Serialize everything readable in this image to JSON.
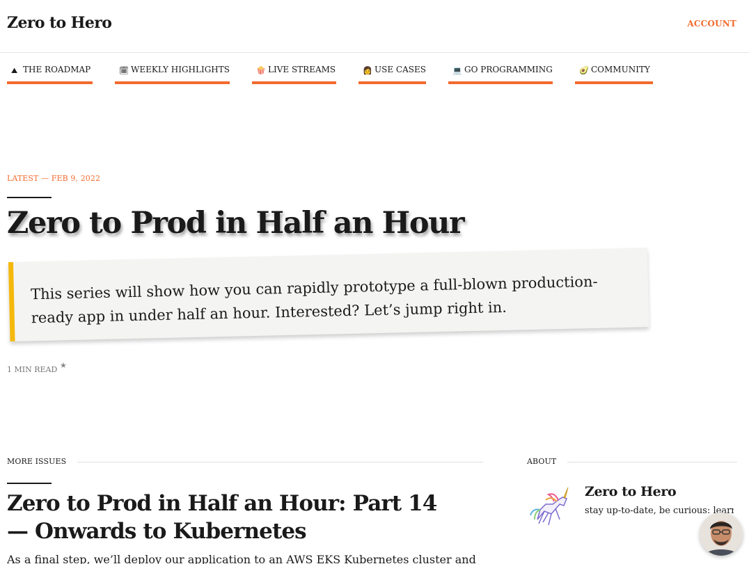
{
  "header": {
    "logo": "Zero to Hero",
    "account": "ACCOUNT"
  },
  "nav": [
    {
      "emoji": "⛰",
      "icon": "mountain-icon",
      "label": "THE ROADMAP"
    },
    {
      "emoji": "🗓",
      "icon": "calendar-icon",
      "label": "WEEKLY HIGHLIGHTS"
    },
    {
      "emoji": "🍿",
      "icon": "popcorn-icon",
      "label": "LIVE STREAMS"
    },
    {
      "emoji": "👩",
      "icon": "person-icon",
      "label": "USE CASES"
    },
    {
      "emoji": "💻",
      "icon": "laptop-icon",
      "label": "GO PROGRAMMING"
    },
    {
      "emoji": "🥑",
      "icon": "avocado-icon",
      "label": "COMMUNITY"
    }
  ],
  "hero": {
    "meta": "LATEST — FEB 9, 2022",
    "title": "Zero to Prod in Half an Hour",
    "callout": "This series will show how you can rapidly prototype a full-blown production-ready app in under half an hour. Interested? Let’s jump right in.",
    "read_time": "1 MIN READ",
    "star_icon": "star-icon"
  },
  "more_issues": {
    "label": "MORE ISSUES",
    "title": "Zero to Prod in Half an Hour: Part 14 — Onwards to Kubernetes",
    "excerpt": "As a final step, we’ll deploy our application to an AWS EKS Kubernetes cluster and"
  },
  "about": {
    "label": "ABOUT",
    "name": "Zero to Hero",
    "description": "stay up-to-date, be curious: learn"
  },
  "colors": {
    "accent": "#f26a2e",
    "callout_border": "#f5b80c",
    "callout_bg": "#f4f4f2"
  }
}
